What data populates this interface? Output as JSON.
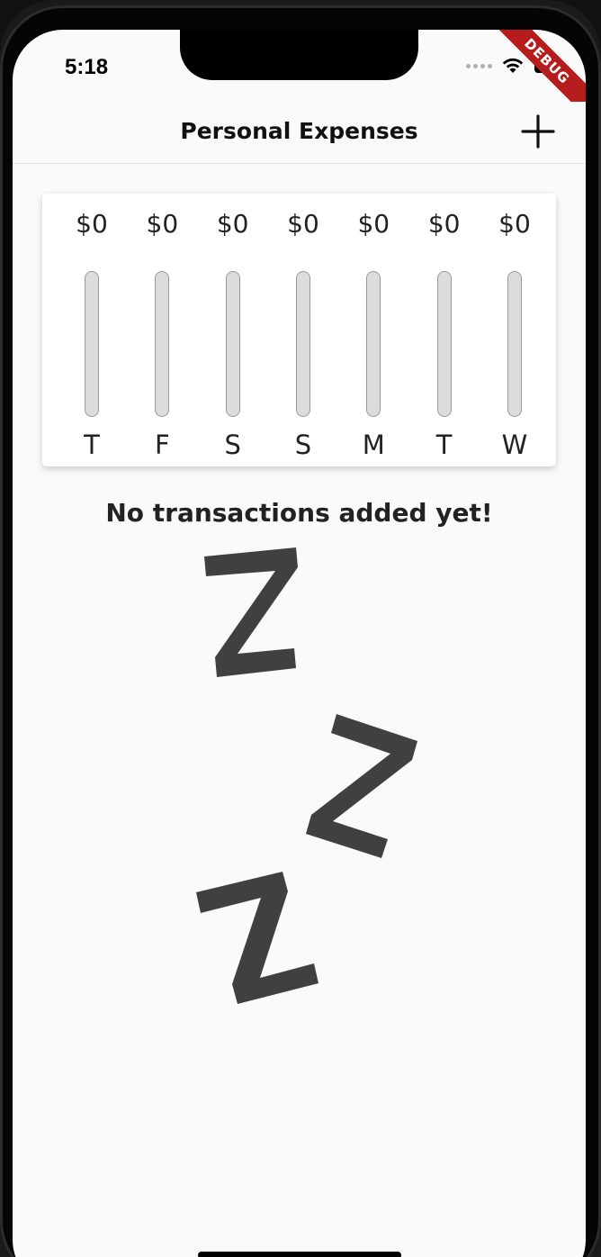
{
  "status_bar": {
    "time": "5:18"
  },
  "debug_banner": {
    "label": "DEBUG"
  },
  "app_bar": {
    "title": "Personal Expenses",
    "add_icon": "plus-icon"
  },
  "chart_data": {
    "type": "bar",
    "categories": [
      "T",
      "F",
      "S",
      "S",
      "M",
      "T",
      "W"
    ],
    "values": [
      0,
      0,
      0,
      0,
      0,
      0,
      0
    ],
    "amount_labels": [
      "$0",
      "$0",
      "$0",
      "$0",
      "$0",
      "$0",
      "$0"
    ]
  },
  "empty_state": {
    "message": "No transactions added yet!",
    "illustration": "sleeping-zzz-illustration"
  },
  "colors": {
    "background": "#fafafa",
    "bar_track": "#dcdcdc",
    "text": "#222222",
    "debug_banner": "#b71c1c"
  }
}
